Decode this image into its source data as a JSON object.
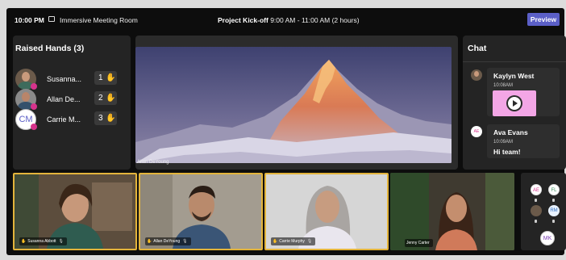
{
  "topbar": {
    "time": "10:00 PM",
    "mode_icon": "window-icon",
    "mode": "Immersive Meeting Room",
    "meeting_title": "Project Kick-off",
    "meeting_time": "9:00 AM - 11:00 AM (2 hours)",
    "preview_label": "Preview"
  },
  "raised_hands": {
    "title": "Raised Hands (3)",
    "items": [
      {
        "name": "Susanna...",
        "order": "1",
        "icon": "raised-hand-icon"
      },
      {
        "name": "Allan De...",
        "order": "2",
        "icon": "raised-hand-icon"
      },
      {
        "name": "Carrie M...",
        "order": "3",
        "icon": "raised-hand-icon",
        "initials": "CM"
      }
    ]
  },
  "stage": {
    "presenter": "Allan DeYoung"
  },
  "chat": {
    "title": "Chat",
    "messages": [
      {
        "sender": "Kaylyn West",
        "time": "10:08AM",
        "attachment": "gif-play-icon"
      },
      {
        "sender": "Ava Evans",
        "initials": "AE",
        "time": "10:09AM",
        "text": "Hi team!"
      }
    ]
  },
  "tiles": [
    {
      "name": "Susanna Abbott",
      "hand": true,
      "highlighted": true
    },
    {
      "name": "Allan DeYoung",
      "hand": true,
      "highlighted": true
    },
    {
      "name": "Carrie Murphy",
      "hand": true,
      "highlighted": true
    },
    {
      "name": "Jenny Carter",
      "hand": false,
      "highlighted": false
    }
  ],
  "people": {
    "initials": [
      "AE",
      "FL",
      "RM",
      "MK"
    ]
  },
  "colors": {
    "accent": "#5b5fc7",
    "raise_hand": "#f2b21c",
    "highlight_border": "#e3b43b",
    "status_dot": "#d6338c"
  }
}
